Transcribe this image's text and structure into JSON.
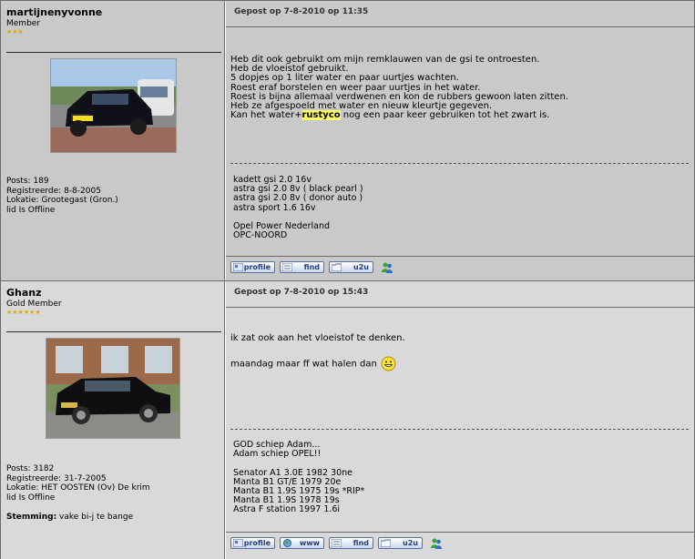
{
  "posts": [
    {
      "username": "martijnenyvonne",
      "rank": "Member",
      "stars": "★★★",
      "stats": {
        "posts": "Posts: 189",
        "registered": "Registreerde: 8-8-2005",
        "location": "Lokatie: Grootegast (Gron.)",
        "status": "lid Is Offline"
      },
      "posted": "Gepost op 7-8-2010 op 11:35",
      "message_lines": [
        "Heb dit ook gebruikt om mijn remklauwen van de gsi te ontroesten.",
        "Heb de vloeistof gebruikt.",
        "5 dopjes op 1 liter water en paar uurtjes wachten.",
        "Roest eraf borstelen en weer paar uurtjes in het water.",
        "Roest is bijna allemaal verdwenen en kon de rubbers gewoon laten zitten.",
        "Heb ze afgespoeld met water en nieuw kleurtje gegeven."
      ],
      "last_line_pre": "Kan het water+",
      "last_line_hl": "rustyco",
      "last_line_post": " nog een paar keer gebruiken tot het zwart is.",
      "signature_lines": [
        "kadett gsi 2.0 16v",
        "astra gsi 2.0 8v ( black pearl )",
        "astra gsi 2.0 8v ( donor auto )",
        "astra sport 1.6 16v",
        "",
        "Opel Power Nederland",
        "OPC-NOORD"
      ],
      "buttons": [
        "profile",
        "find",
        "u2u"
      ]
    },
    {
      "username": "Ghanz",
      "rank": "Gold Member",
      "stars": "★★★★★★",
      "stats": {
        "posts": "Posts: 3182",
        "registered": "Registreerde: 31-7-2005",
        "location": "Lokatie: HET OOSTEN (Ov) De krim",
        "status": "lid Is Offline",
        "mood_label": "Stemming:",
        "mood_value": " vake bi-j te bange"
      },
      "posted": "Gepost op 7-8-2010 op 15:43",
      "message_lines": [
        "ik zat ook aan het vloeistof te denken.",
        "maandag maar ff wat halen dan"
      ],
      "signature_lines": [
        "GOD schiep Adam...",
        "Adam schiep OPEL!!",
        "",
        "Senator A1 3.0E 1982 30ne",
        "Manta B1 GT/E 1979 20e",
        "Manta B1 1.9S 1975 19s *RIP*",
        "Manta B1 1.9S 1978 19s",
        "Astra F station 1997 1.6i"
      ],
      "buttons": [
        "profile",
        "www",
        "find",
        "u2u"
      ]
    }
  ],
  "colors": {
    "post1_bg": "#c9c9c9",
    "post2_bg": "#d9d9d9",
    "highlight": "#ffff66",
    "button_text": "#24407a",
    "stars": "#e0a800"
  }
}
